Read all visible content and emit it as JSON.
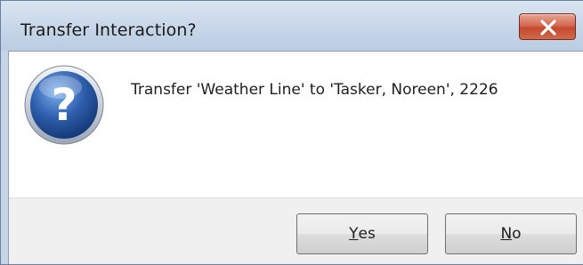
{
  "window": {
    "title": "Transfer Interaction?",
    "close_icon": "close-icon",
    "close_color": "#c44a2e"
  },
  "dialog": {
    "icon": "question-icon",
    "icon_color": "#2f5fae",
    "message": "Transfer 'Weather Line' to 'Tasker, Noreen', 2226"
  },
  "buttons": {
    "yes": {
      "mnemonic": "Y",
      "rest": "es"
    },
    "no": {
      "mnemonic": "N",
      "rest": "o"
    }
  }
}
